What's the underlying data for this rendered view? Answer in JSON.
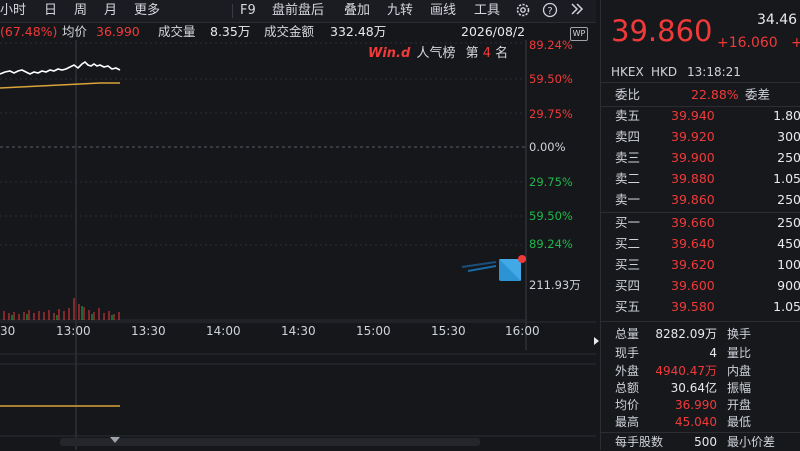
{
  "toolbar": {
    "items": [
      "小时",
      "日",
      "周",
      "月",
      "更多",
      "F9",
      "盘前盘后",
      "叠加",
      "九转",
      "画线",
      "工具"
    ],
    "icons": [
      "gear-icon",
      "help-icon",
      "double-chevron-right-icon"
    ]
  },
  "info_bar": {
    "change_pct": "(67.48%)",
    "avg_label": "均价",
    "avg_value": "36.990",
    "volume_label": "成交量",
    "volume_value": "8.35万",
    "amount_label": "成交金额",
    "amount_value": "332.48万",
    "date": "2026/08/2"
  },
  "chart": {
    "right_axis": [
      "89.24%",
      "59.50%",
      "29.75%",
      "0.00%",
      "29.75%",
      "59.50%",
      "89.24%"
    ],
    "volume_axis_label": "211.93万",
    "time_labels": [
      "30",
      "13:00",
      "13:30",
      "14:00",
      "14:30",
      "15:00",
      "15:30",
      "16:00"
    ],
    "popularity": {
      "logo": "Win.d",
      "label": "人气榜",
      "rank_prefix": "第",
      "rank": "4",
      "rank_suffix": "名"
    },
    "badge": "WP"
  },
  "quote": {
    "price": "39.860",
    "prev_partial": "34.46",
    "change": "+16.060",
    "change_partial": "+",
    "exchange": "HKEX",
    "currency": "HKD",
    "time": "13:18:21",
    "weibi_label": "委比",
    "weibi_value": "22.88%",
    "weicha_label": "委差"
  },
  "order_book": {
    "asks": [
      {
        "label": "卖五",
        "price": "39.940",
        "vol": "1.80"
      },
      {
        "label": "卖四",
        "price": "39.920",
        "vol": "300"
      },
      {
        "label": "卖三",
        "price": "39.900",
        "vol": "250"
      },
      {
        "label": "卖二",
        "price": "39.880",
        "vol": "1.05"
      },
      {
        "label": "卖一",
        "price": "39.860",
        "vol": "250"
      }
    ],
    "bids": [
      {
        "label": "买一",
        "price": "39.660",
        "vol": "250"
      },
      {
        "label": "买二",
        "price": "39.640",
        "vol": "450"
      },
      {
        "label": "买三",
        "price": "39.620",
        "vol": "100"
      },
      {
        "label": "买四",
        "price": "39.600",
        "vol": "900"
      },
      {
        "label": "买五",
        "price": "39.580",
        "vol": "1.05"
      }
    ]
  },
  "stats": [
    {
      "l1": "总量",
      "v1": "8282.09万",
      "c1": "white",
      "l2": "换手"
    },
    {
      "l1": "现手",
      "v1": "4",
      "c1": "white",
      "l2": "量比"
    },
    {
      "l1": "外盘",
      "v1": "4940.47万",
      "c1": "red",
      "l2": "内盘"
    },
    {
      "l1": "总额",
      "v1": "30.64亿",
      "c1": "white",
      "l2": "振幅"
    },
    {
      "l1": "均价",
      "v1": "36.990",
      "c1": "red",
      "l2": "开盘"
    },
    {
      "l1": "最高",
      "v1": "45.040",
      "c1": "red",
      "l2": "最低"
    },
    {
      "l1": "每手股数",
      "v1": "500",
      "c1": "white",
      "l2": "最小价差"
    }
  ],
  "colors": {
    "up": "#f03a3a",
    "down": "#21b84a",
    "avg_line": "#d9a43a",
    "price_line": "#ffffff"
  }
}
